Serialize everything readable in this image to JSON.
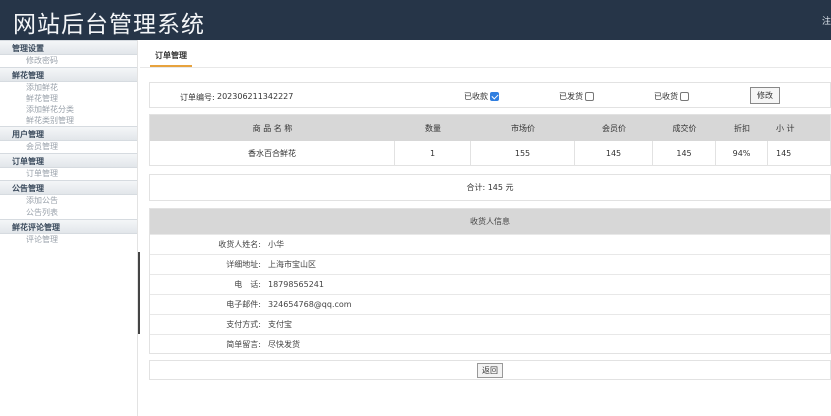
{
  "header": {
    "title": "网站后台管理系统",
    "logout": "注"
  },
  "sidebar": {
    "groups": [
      {
        "title": "管理设置",
        "items": [
          "修改密码"
        ]
      },
      {
        "title": "鲜花管理",
        "items": [
          "添加鲜花",
          "鲜花管理",
          "添加鲜花分类",
          "鲜花类别管理"
        ]
      },
      {
        "title": "用户管理",
        "items": [
          "会员管理"
        ]
      },
      {
        "title": "订单管理",
        "items": [
          "订单管理"
        ]
      },
      {
        "title": "公告管理",
        "items": [
          "添加公告",
          "公告列表"
        ]
      },
      {
        "title": "鲜花评论管理",
        "items": [
          "评论管理"
        ]
      }
    ]
  },
  "main": {
    "tab": "订单管理",
    "order": {
      "no_label": "订单编号:",
      "no_value": "202306211342227",
      "paid_label": "已收款",
      "paid_checked": true,
      "shipped_label": "已发货",
      "shipped_checked": false,
      "received_label": "已收货",
      "received_checked": false,
      "modify": "修改"
    },
    "goods": {
      "columns": [
        "商 品 名 称",
        "数量",
        "市场价",
        "会员价",
        "成交价",
        "折扣",
        "小 计"
      ],
      "rows": [
        [
          "香水百合鲜花",
          "1",
          "155",
          "145",
          "145",
          "94%",
          "145"
        ]
      ]
    },
    "total": "合计: 145 元",
    "receiver": {
      "title": "收货人信息",
      "fields": [
        {
          "label": "收货人姓名:",
          "value": "小华"
        },
        {
          "label": "详细地址:",
          "value": "上海市宝山区"
        },
        {
          "label": "电　话:",
          "value": "18798565241"
        },
        {
          "label": "电子邮件:",
          "value": "324654768@qq.com"
        },
        {
          "label": "支付方式:",
          "value": "支付宝"
        },
        {
          "label": "简单留言:",
          "value": "尽快发货"
        }
      ]
    },
    "back": "返回"
  }
}
